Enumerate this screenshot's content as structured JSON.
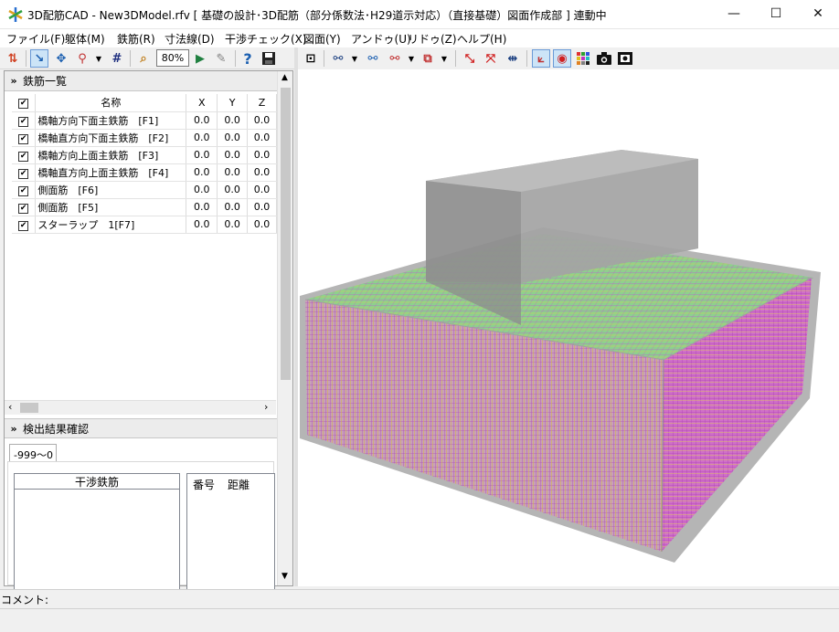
{
  "window": {
    "title": "3D配筋CAD - New3DModel.rfv [ 基礎の設計･3D配筋（部分係数法･H29道示対応）（直接基礎）図面作成部 ] 連動中",
    "minimize_glyph": "—",
    "maximize_glyph": "☐",
    "close_glyph": "✕"
  },
  "menu": {
    "items": [
      {
        "label": "ファイル(F)"
      },
      {
        "label": "躯体(M)"
      },
      {
        "label": "鉄筋(R)"
      },
      {
        "label": "寸法線(D)"
      },
      {
        "label": "干渉チェック(X)"
      },
      {
        "label": "図面(Y)"
      },
      {
        "label": "アンドゥ(U)"
      },
      {
        "label": "リドゥ(Z)"
      },
      {
        "label": "ヘルプ(H)"
      }
    ]
  },
  "toolbar": {
    "zoom_value": "80%",
    "help_glyph": "?",
    "icons": [
      "sort-icon",
      "select-icon",
      "move-icon",
      "rebar-edit-icon",
      "grid-icon",
      "zoom-fit-icon",
      "play-icon",
      "export-icon",
      "help-icon",
      "save-icon",
      "fit-view-icon",
      "find-icon",
      "find-next-icon",
      "find-prev-icon",
      "layer-icon",
      "node-icon",
      "cross-icon",
      "dimension-icon",
      "axis-icon",
      "target-icon",
      "palette-icon",
      "camera-icon",
      "capture-icon"
    ]
  },
  "rebar_list": {
    "title": "鉄筋一覧",
    "columns": {
      "check": "✔",
      "name": "名称",
      "x": "X",
      "y": "Y",
      "z": "Z"
    },
    "rows": [
      {
        "name": "橋軸方向下面主鉄筋　[F1]",
        "x": "0.0",
        "y": "0.0",
        "z": "0.0"
      },
      {
        "name": "橋軸直方向下面主鉄筋　[F2]",
        "x": "0.0",
        "y": "0.0",
        "z": "0.0"
      },
      {
        "name": "橋軸方向上面主鉄筋　[F3]",
        "x": "0.0",
        "y": "0.0",
        "z": "0.0"
      },
      {
        "name": "橋軸直方向上面主鉄筋　[F4]",
        "x": "0.0",
        "y": "0.0",
        "z": "0.0"
      },
      {
        "name": "側面筋　[F6]",
        "x": "0.0",
        "y": "0.0",
        "z": "0.0"
      },
      {
        "name": "側面筋　[F5]",
        "x": "0.0",
        "y": "0.0",
        "z": "0.0"
      },
      {
        "name": "スターラップ　1[F7]",
        "x": "0.0",
        "y": "0.0",
        "z": "0.0"
      }
    ]
  },
  "detection": {
    "title": "検出結果確認",
    "tab_label": "-999〜0",
    "interfering_label": "干渉鉄筋",
    "number_label": "番号",
    "distance_label": "距離"
  },
  "status": {
    "comment_label": "コメント:"
  },
  "colors": {
    "rebar_green": "#6fd07a",
    "rebar_magenta": "#c05cc0",
    "rebar_yellow": "#d8c040",
    "concrete_gray": "#b0b0b0",
    "column_gray": "#9a9a9a"
  }
}
